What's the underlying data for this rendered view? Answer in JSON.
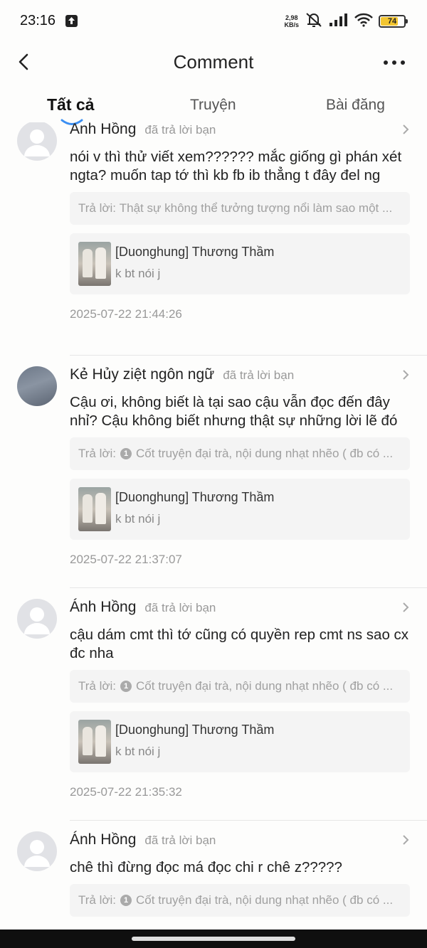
{
  "status_bar": {
    "time": "23:16",
    "net_speed_value": "2,98",
    "net_speed_unit": "KB/s",
    "battery_level": "74",
    "battery_color": "#f2c530"
  },
  "header": {
    "title": "Comment"
  },
  "tabs": [
    {
      "label": "Tất cả",
      "active": true
    },
    {
      "label": "Truyện",
      "active": false
    },
    {
      "label": "Bài đăng",
      "active": false
    }
  ],
  "notifications": [
    {
      "name": "Ánh Hồng",
      "action": "đã trả lời bạn",
      "comment": "nói v thì thử viết xem?????? mắc giống gì phán xét ngta? muốn tap tớ thì kb fb ib thẳng t đây đel ng",
      "reply_prefix": "Trả lời:",
      "reply_text": "Thật sự không thể tưởng tượng nổi làm sao một ...",
      "story_title": "[Duonghung] Thương Thầm",
      "story_excerpt": "k bt nói j",
      "timestamp": "2025-07-22 21:44:26"
    },
    {
      "name": "Kẻ Hủy ziệt ngôn ngữ",
      "action": "đã trả lời bạn",
      "comment": "Cậu ơi, không biết là tại sao cậu vẫn đọc đến đây nhỉ? Cậu không biết nhưng thật sự những lời lẽ đó",
      "reply_prefix": "Trả lời:",
      "reply_num": "1",
      "reply_text": "Cốt truyện đại trà, nội dung nhạt nhẽo ( đb có ...",
      "story_title": "[Duonghung] Thương Thầm",
      "story_excerpt": "k bt nói j",
      "timestamp": "2025-07-22 21:37:07"
    },
    {
      "name": "Ánh Hồng",
      "action": "đã trả lời bạn",
      "comment": "cậu dám cmt thì tớ cũng có quyền rep cmt ns sao cx đc nha",
      "reply_prefix": "Trả lời:",
      "reply_num": "1",
      "reply_text": "Cốt truyện đại trà, nội dung nhạt nhẽo ( đb có ...",
      "story_title": "[Duonghung] Thương Thầm",
      "story_excerpt": "k bt nói j",
      "timestamp": "2025-07-22 21:35:32"
    },
    {
      "name": "Ánh Hồng",
      "action": "đã trả lời bạn",
      "comment": "chê thì đừng đọc má đọc chi r chê z?????",
      "reply_prefix": "Trả lời:",
      "reply_num": "1",
      "reply_text": "Cốt truyện đại trà, nội dung nhạt nhẽo ( đb có ..."
    }
  ],
  "icons": {
    "back": "back-arrow-icon",
    "more": "more-dots-icon",
    "chevron": "chevron-right-icon",
    "avatar_default": "default-avatar-icon"
  }
}
